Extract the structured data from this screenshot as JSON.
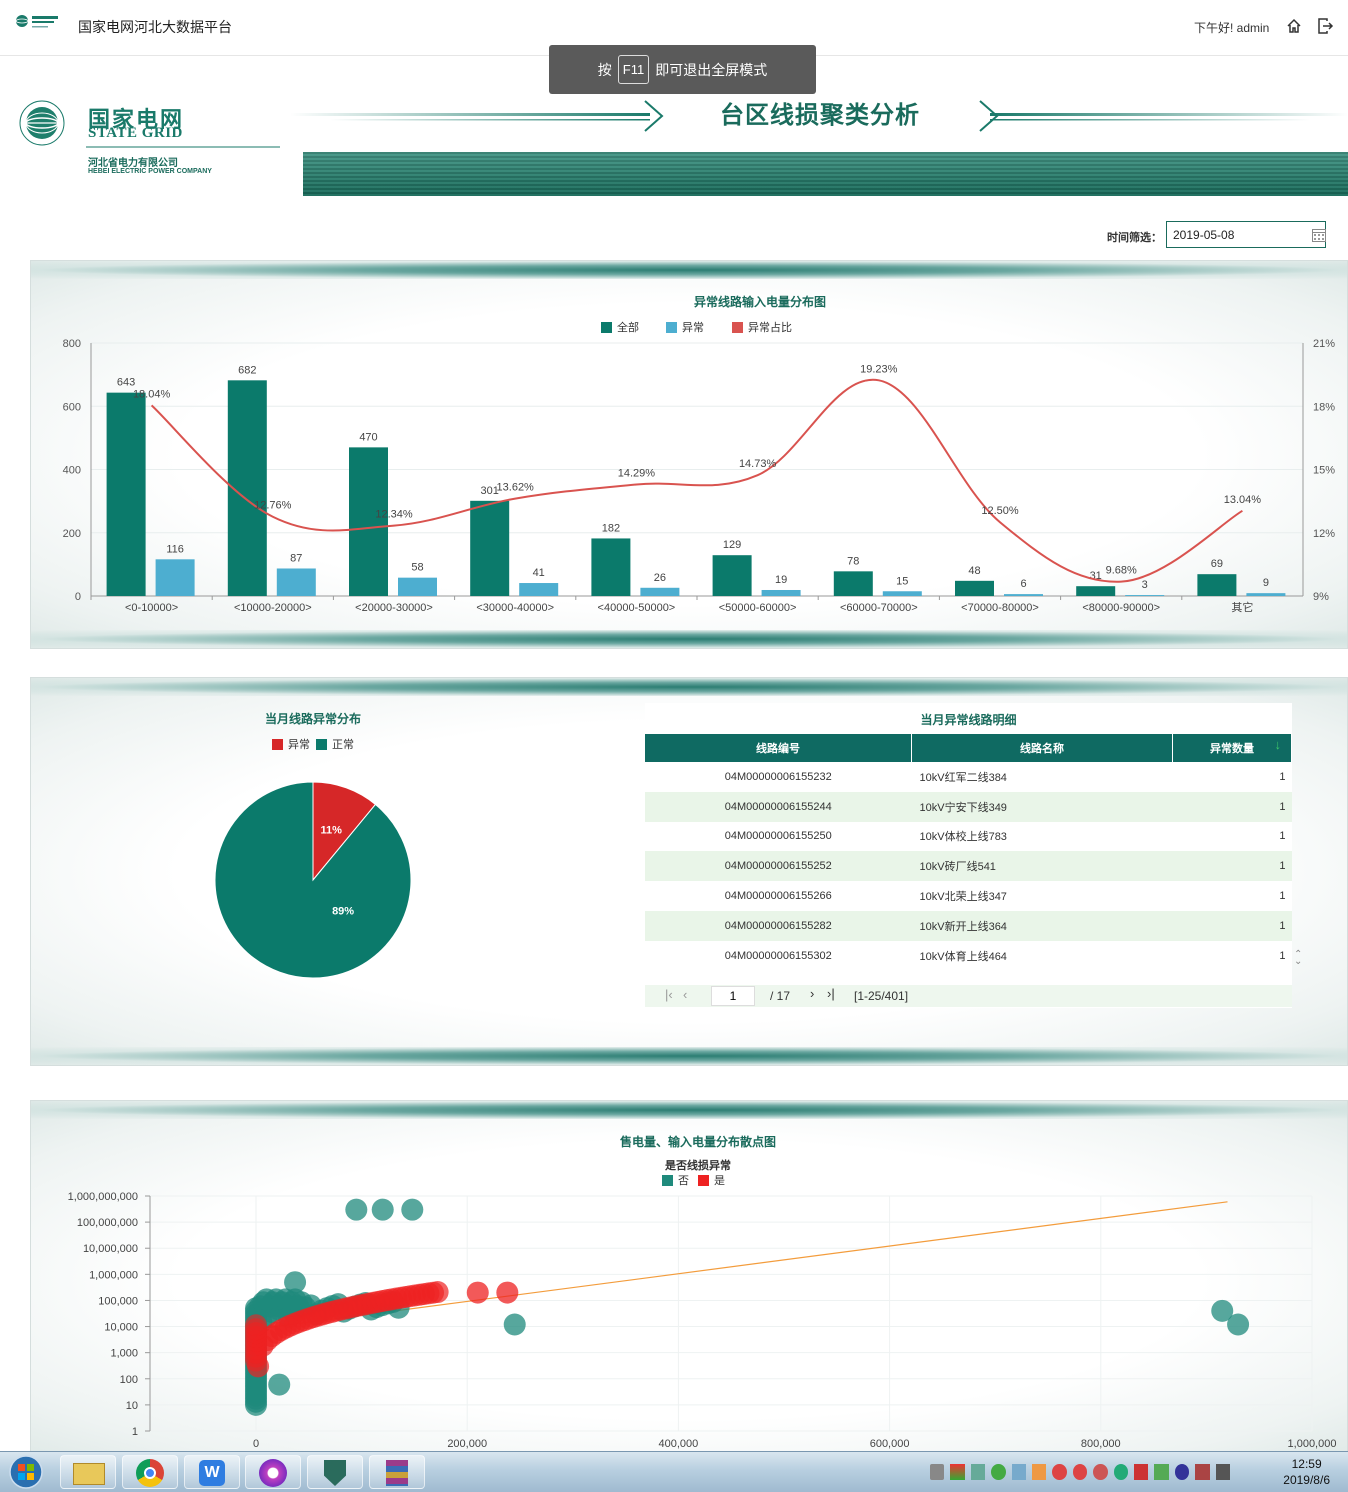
{
  "topbar": {
    "app_title": "国家电网河北大数据平台",
    "greeting": "下午好! admin",
    "home_icon": "home-icon",
    "logout_icon": "logout-icon"
  },
  "toast": {
    "prefix": "按",
    "key": "F11",
    "suffix": "即可退出全屏模式"
  },
  "header": {
    "title": "台区线损聚类分析",
    "logo_cn": "国家电网",
    "logo_en": "STATE GRID",
    "company_cn": "河北省电力有限公司",
    "company_en": "HEBEI ELECTRIC POWER COMPANY"
  },
  "filter": {
    "label": "时间筛选：",
    "value": "2019-05-08",
    "icon": "calendar-icon"
  },
  "colors": {
    "brand": "#1a6b5c",
    "all": "#0b7a6b",
    "abnormal": "#4daed0",
    "ratio": "#d9534f",
    "pie_abn": "#d62728",
    "pie_norm": "#0b7a6b",
    "scatter_no": "#1f8a7c",
    "scatter_yes": "#ee2222"
  },
  "chart_data": [
    {
      "type": "bar",
      "title": "异常线路输入电量分布图",
      "categories": [
        "<0-10000>",
        "<10000-20000>",
        "<20000-30000>",
        "<30000-40000>",
        "<40000-50000>",
        "<50000-60000>",
        "<60000-70000>",
        "<70000-80000>",
        "<80000-90000>",
        "其它"
      ],
      "series": [
        {
          "name": "全部",
          "values": [
            643,
            682,
            470,
            301,
            182,
            129,
            78,
            48,
            31,
            69
          ]
        },
        {
          "name": "异常",
          "values": [
            116,
            87,
            58,
            41,
            26,
            19,
            15,
            6,
            3,
            9
          ]
        },
        {
          "name": "异常占比",
          "type": "line",
          "axis": "right",
          "values": [
            18.04,
            12.76,
            12.34,
            13.62,
            14.29,
            14.73,
            19.23,
            12.5,
            9.68,
            13.04
          ],
          "labels": [
            "18.04%",
            "12.76%",
            "12.34%",
            "13.62%",
            "14.29%",
            "14.73%",
            "19.23%",
            "12.50%",
            "9.68%",
            "13.04%"
          ]
        }
      ],
      "ylim": [
        0,
        800
      ],
      "yticks": [
        "0",
        "200",
        "400",
        "600",
        "800"
      ],
      "y2lim": [
        9,
        21
      ],
      "y2ticks": [
        "9%",
        "12%",
        "15%",
        "18%",
        "21%"
      ],
      "legend": "top-center"
    },
    {
      "type": "pie",
      "title": "当月线路异常分布",
      "labels": [
        "异常",
        "正常"
      ],
      "values": [
        11,
        89
      ],
      "value_labels": [
        "11%",
        "89%"
      ],
      "legend": "top-center"
    },
    {
      "type": "scatter",
      "title": "售电量、输入电量分布散点图",
      "legend_title": "是否线损异常",
      "series_names": [
        "否",
        "是"
      ],
      "xlim": [
        0,
        1000000
      ],
      "xticks": [
        "0",
        "200,000",
        "400,000",
        "600,000",
        "800,000",
        "1,000,000"
      ],
      "yscale": "log",
      "ylim": [
        1,
        1000000000
      ],
      "yticks": [
        "1",
        "10",
        "100",
        "1,000",
        "10,000",
        "100,000",
        "1,000,000",
        "10,000,000",
        "100,000,000",
        "1,000,000,000"
      ],
      "trend_line": {
        "from": [
          0,
          8000
        ],
        "to": [
          920000,
          600000000
        ]
      },
      "outliers_no": [
        [
          95000,
          300000000
        ],
        [
          120000,
          300000000
        ],
        [
          148000,
          300000000
        ],
        [
          37000,
          500000
        ],
        [
          245000,
          12000
        ],
        [
          22000,
          60
        ],
        [
          915000,
          40000
        ],
        [
          930000,
          12000
        ]
      ],
      "outliers_yes": [
        [
          210000,
          200000
        ],
        [
          238000,
          200000
        ]
      ]
    }
  ],
  "table": {
    "title": "当月异常线路明细",
    "headers": [
      "线路编号",
      "线路名称",
      "异常数量"
    ],
    "sort_icon": "sort-down-icon",
    "rows": [
      [
        "04M00000006155232",
        "10kV红军二线384",
        "1"
      ],
      [
        "04M00000006155244",
        "10kV宁安下线349",
        "1"
      ],
      [
        "04M00000006155250",
        "10kV体校上线783",
        "1"
      ],
      [
        "04M00000006155252",
        "10kV砖厂线541",
        "1"
      ],
      [
        "04M00000006155266",
        "10kV北荣上线347",
        "1"
      ],
      [
        "04M00000006155282",
        "10kV新开上线364",
        "1"
      ],
      [
        "04M00000006155302",
        "10kV体育上线464",
        "1"
      ]
    ],
    "pager": {
      "page": "1",
      "total": "/ 17",
      "range": "[1-25/401]"
    }
  },
  "taskbar": {
    "apps": [
      "start-orb",
      "file-explorer-icon",
      "chrome-icon",
      "wps-icon",
      "media-player-icon",
      "shield-app-icon",
      "winrar-icon"
    ],
    "time": "12:59",
    "date": "2019/8/6"
  }
}
